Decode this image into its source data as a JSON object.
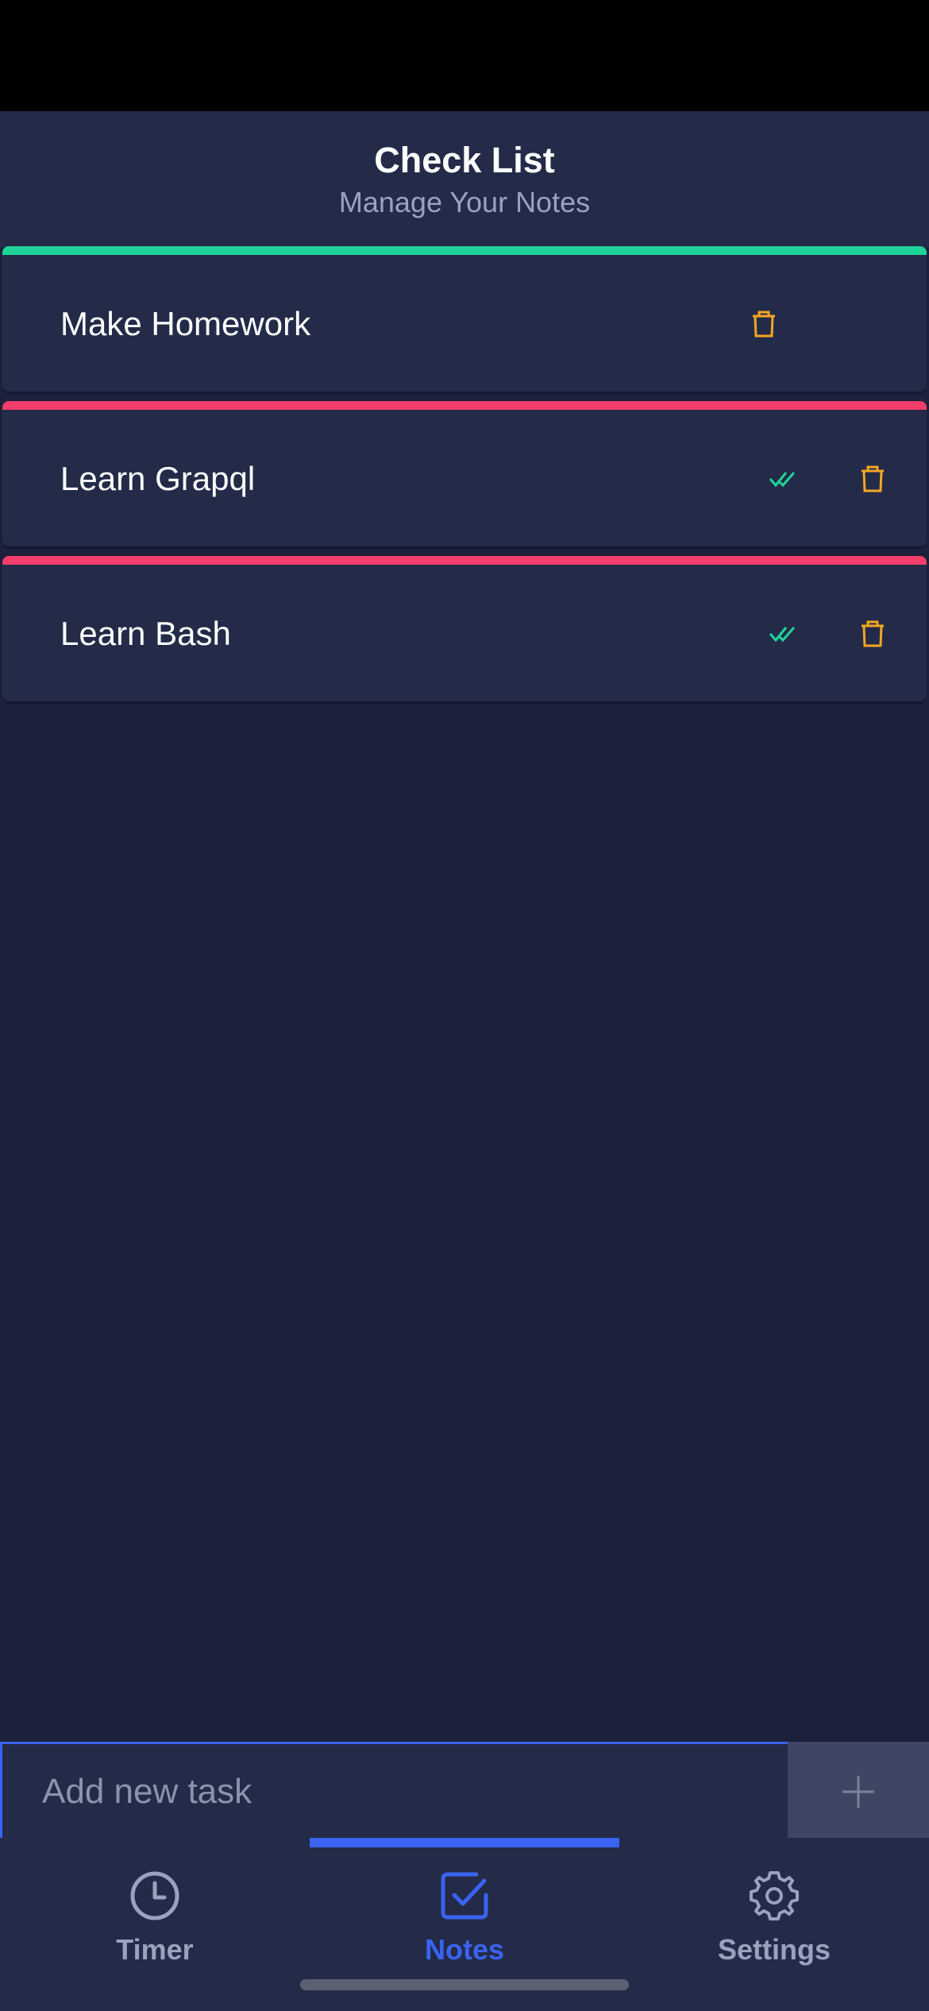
{
  "header": {
    "title": "Check List",
    "subtitle": "Manage Your Notes"
  },
  "tasks": [
    {
      "label": "Make Homework",
      "status": "done",
      "strip_color": "#1fd49a",
      "show_check": false
    },
    {
      "label": "Learn Grapql",
      "status": "pending",
      "strip_color": "#f33d6a",
      "show_check": true
    },
    {
      "label": "Learn Bash",
      "status": "pending",
      "strip_color": "#f33d6a",
      "show_check": true
    }
  ],
  "input": {
    "placeholder": "Add new task",
    "add_icon": "plus-icon"
  },
  "tabs": [
    {
      "label": "Timer",
      "icon": "clock-icon",
      "active": false
    },
    {
      "label": "Notes",
      "icon": "checkbox-icon",
      "active": true
    },
    {
      "label": "Settings",
      "icon": "gear-icon",
      "active": false
    }
  ],
  "colors": {
    "accent": "#3a63f2",
    "delete": "#f5a623",
    "check": "#1fd49a",
    "tab_inactive": "#9aa3bd"
  }
}
